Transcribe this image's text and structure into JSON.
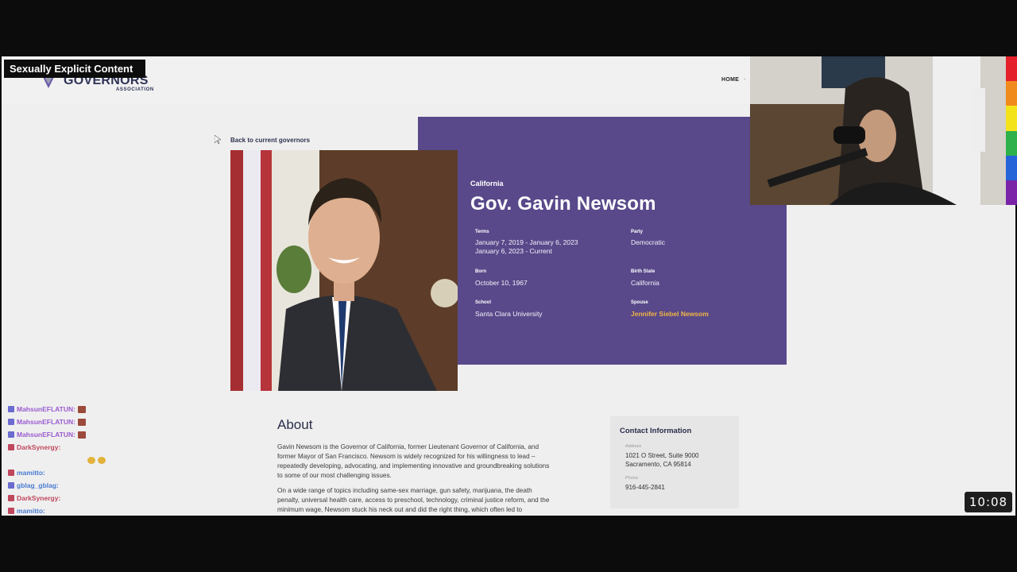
{
  "overlay": {
    "content_warning": "Sexually Explicit Content",
    "timer": "10:08"
  },
  "site": {
    "logo": {
      "word": "GOVERNORS",
      "sub": "ASSOCIATION"
    },
    "nav": {
      "home": "HOME",
      "sep": "·"
    },
    "back_link": "Back to current governors"
  },
  "governor": {
    "state": "California",
    "name": "Gov. Gavin Newsom",
    "facts": {
      "terms_label": "Terms",
      "terms": [
        "January 7, 2019 - January 6, 2023",
        "January 6, 2023 - Current"
      ],
      "party_label": "Party",
      "party": "Democratic",
      "born_label": "Born",
      "born": "October 10, 1967",
      "birth_state_label": "Birth State",
      "birth_state": "California",
      "school_label": "School",
      "school": "Santa Clara University",
      "spouse_label": "Spouse",
      "spouse": "Jennifer Siebel Newsom"
    }
  },
  "about": {
    "title": "About",
    "paragraphs": [
      "Gavin Newsom is the Governor of California, former Lieutenant Governor of California, and former Mayor of San Francisco. Newsom is widely recognized for his willingness to lead – repeatedly developing, advocating, and implementing innovative and groundbreaking solutions to some of our most challenging issues.",
      "On a wide range of topics including same-sex marriage, gun safety, marijuana, the death penalty, universal health care, access to preschool, technology, criminal justice reform, and the minimum wage, Newsom stuck his neck out and did the right thing, which often led to"
    ]
  },
  "contact": {
    "title": "Contact Information",
    "address_label": "Address",
    "address_line1": "1021 O Street, Suite 9000",
    "address_line2": "Sacramento, CA 95814",
    "phone_label": "Phone",
    "phone": "916-445-2841"
  },
  "chat": [
    {
      "user": "MahsunEFLATUN:",
      "color": "#9a5cd0",
      "badge": "#6b6bd0",
      "msg": "",
      "emote": "square"
    },
    {
      "user": "MahsunEFLATUN:",
      "color": "#9a5cd0",
      "badge": "#6b6bd0",
      "msg": "",
      "emote": "square"
    },
    {
      "user": "MahsunEFLATUN:",
      "color": "#9a5cd0",
      "badge": "#6b6bd0",
      "msg": "",
      "emote": "square"
    },
    {
      "user": "DarkSynergy:",
      "color": "#c0475d",
      "badge": "#c0475d",
      "msg": "",
      "emote": "none"
    },
    {
      "user": "",
      "color": "#c0475d",
      "badge": "",
      "msg": "",
      "emote": "round"
    },
    {
      "user": "mamitto:",
      "color": "#4a7bd1",
      "badge": "#c0475d",
      "msg": "",
      "emote": "none"
    },
    {
      "user": "gblag_gblag:",
      "color": "#4a7bd1",
      "badge": "#6b6bd0",
      "msg": "",
      "emote": "none"
    },
    {
      "user": "DarkSynergy:",
      "color": "#c0475d",
      "badge": "#c0475d",
      "msg": "",
      "emote": "none"
    },
    {
      "user": "mamitto:",
      "color": "#4a7bd1",
      "badge": "#c0475d",
      "msg": "",
      "emote": "none"
    }
  ],
  "colors": {
    "panel": "#59498a",
    "spouse_link": "#f2b544",
    "rainbow": [
      "#e4202a",
      "#f08a1c",
      "#f2e31b",
      "#2db14a",
      "#2563d8",
      "#7a23a8"
    ]
  }
}
